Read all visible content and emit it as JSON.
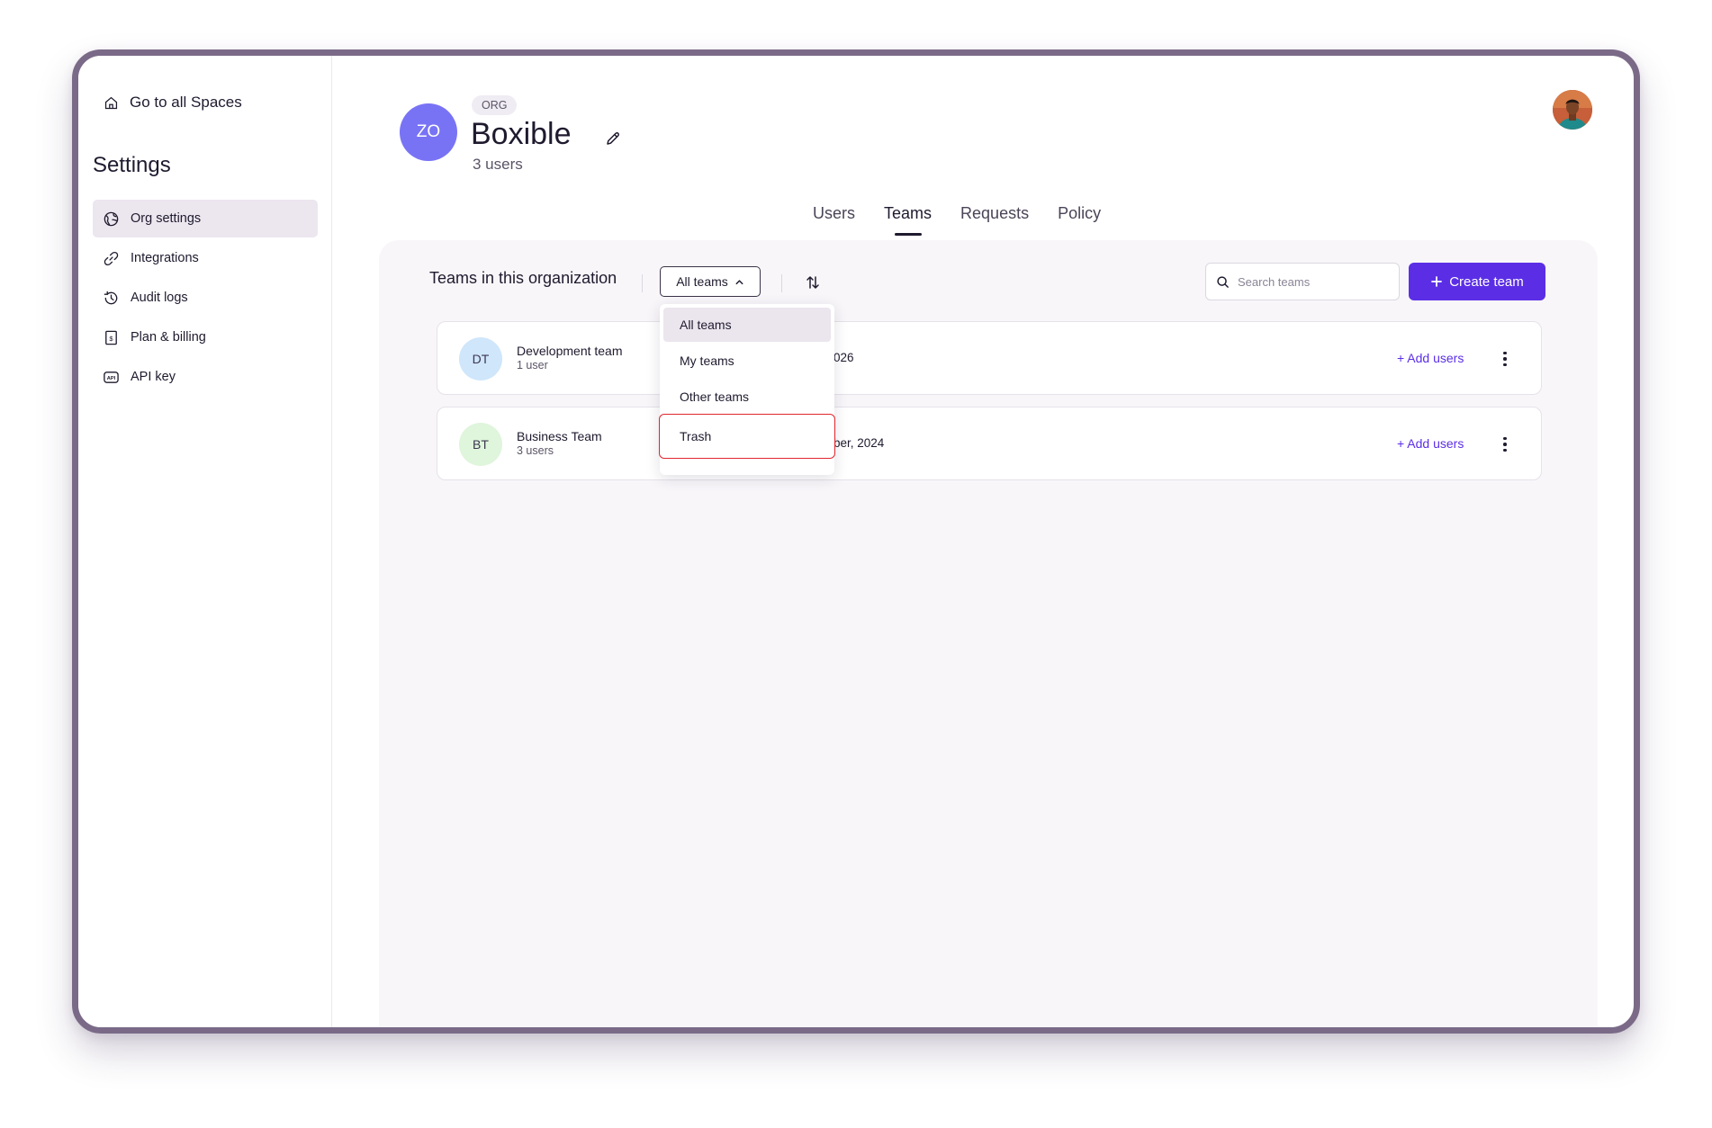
{
  "sidebar": {
    "go_to_spaces": "Go to all Spaces",
    "title": "Settings",
    "items": [
      {
        "label": "Org settings",
        "icon": "org-settings-icon",
        "active": true
      },
      {
        "label": "Integrations",
        "icon": "link-icon",
        "active": false
      },
      {
        "label": "Audit logs",
        "icon": "history-icon",
        "active": false
      },
      {
        "label": "Plan & billing",
        "icon": "billing-icon",
        "active": false
      },
      {
        "label": "API key",
        "icon": "api-key-icon",
        "active": false
      }
    ]
  },
  "org": {
    "avatar_initials": "ZO",
    "badge": "ORG",
    "name": "Boxible",
    "user_count": "3 users"
  },
  "tabs": [
    {
      "label": "Users",
      "active": false
    },
    {
      "label": "Teams",
      "active": true
    },
    {
      "label": "Requests",
      "active": false
    },
    {
      "label": "Policy",
      "active": false
    }
  ],
  "teams_panel": {
    "title": "Teams in this organization",
    "filter_label": "All teams",
    "search_placeholder": "Search teams",
    "create_label": "Create team",
    "rows": [
      {
        "initials": "DT",
        "name": "Development team",
        "count": "1 user",
        "date": "026",
        "add_label": "+ Add users",
        "avatar_color": "#cfe6fb"
      },
      {
        "initials": "BT",
        "name": "Business Team",
        "count": "3 users",
        "date": "ber, 2024",
        "add_label": "+ Add users",
        "avatar_color": "#dff5dc"
      }
    ]
  },
  "dropdown": {
    "items": [
      "All teams",
      "My teams",
      "Other teams",
      "Trash"
    ],
    "selected": "All teams",
    "highlighted": "Trash"
  },
  "colors": {
    "accent": "#5b2ee6",
    "org_avatar": "#7873f5",
    "highlight_border": "#e0262e",
    "active_nav": "#ece6ef"
  }
}
